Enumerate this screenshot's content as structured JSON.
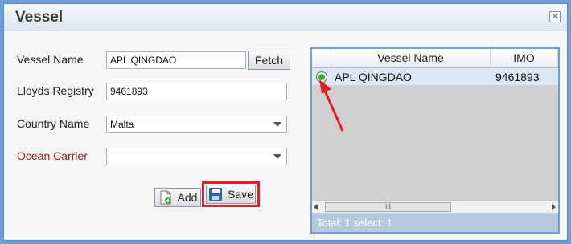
{
  "dialog": {
    "title": "Vessel",
    "close_icon": "close-icon"
  },
  "form": {
    "vessel_name_label": "Vessel Name",
    "vessel_name_value": "APL QINGDAO",
    "fetch_label": "Fetch",
    "lloyds_label": "Lloyds Registry",
    "lloyds_value": "9461893",
    "country_label": "Country Name",
    "country_value": "Malta",
    "carrier_label": "Ocean Carrier",
    "carrier_value": "",
    "add_label": "Add",
    "save_label": "Save"
  },
  "grid": {
    "columns": [
      "Vessel Name",
      "IMO"
    ],
    "rows": [
      {
        "vessel_name": "APL QINGDAO",
        "imo": "9461893",
        "selected": true
      }
    ],
    "scroll_thumb": "III",
    "footer": "Total: 1  select: 1"
  },
  "colors": {
    "accent": "#6e9fd6",
    "highlight": "#e01f2a",
    "carrier_label": "#9a1c1c",
    "selected_radio": "#2fae2f"
  }
}
